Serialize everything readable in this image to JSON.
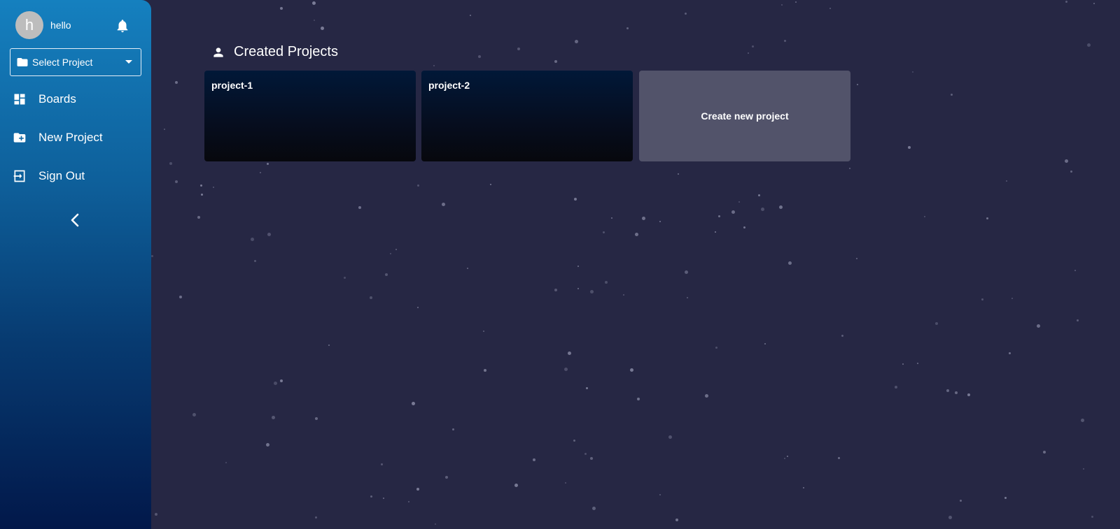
{
  "sidebar": {
    "user": {
      "avatar_letter": "h",
      "name": "hello"
    },
    "select_project": {
      "label": "Select Project"
    },
    "nav": [
      {
        "label": "Boards",
        "icon": "dashboard-icon"
      },
      {
        "label": "New Project",
        "icon": "folder-plus-icon"
      },
      {
        "label": "Sign Out",
        "icon": "sign-out-icon"
      }
    ]
  },
  "main": {
    "title": "Created Projects",
    "projects": [
      {
        "name": "project-1"
      },
      {
        "name": "project-2"
      }
    ],
    "create_label": "Create new project"
  },
  "colors": {
    "background": "#262744",
    "sidebar_top": "#1580bf",
    "sidebar_bottom": "#02184a",
    "create_card": "#52536a"
  }
}
